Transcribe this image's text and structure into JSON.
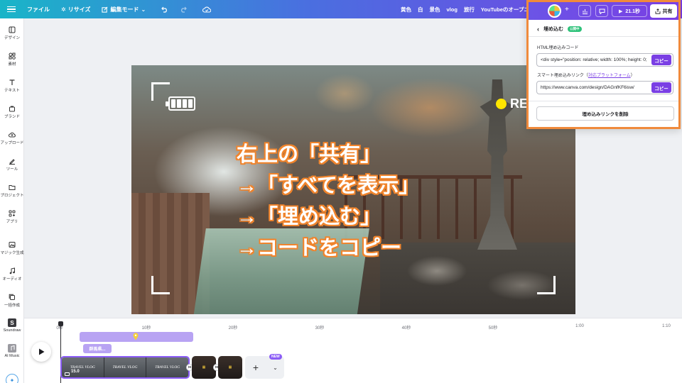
{
  "topbar": {
    "file": "ファイル",
    "resize": "リサイズ",
    "edit_mode": "編集モード",
    "tags": [
      "黄色",
      "白",
      "景色",
      "vlog",
      "旅行",
      "YouTubeのオープニング動画"
    ],
    "duration": "21.1秒",
    "share": "共有"
  },
  "sidebar": {
    "items": [
      {
        "label": "デザイン",
        "icon": "design-icon"
      },
      {
        "label": "素材",
        "icon": "elements-icon"
      },
      {
        "label": "テキスト",
        "icon": "text-icon"
      },
      {
        "label": "ブランド",
        "icon": "brand-icon"
      },
      {
        "label": "アップロード",
        "icon": "upload-icon"
      },
      {
        "label": "ツール",
        "icon": "draw-icon"
      },
      {
        "label": "プロジェクト",
        "icon": "folder-icon"
      },
      {
        "label": "アプリ",
        "icon": "apps-icon"
      },
      {
        "label": "マジック生成",
        "icon": "magic-icon"
      },
      {
        "label": "オーディオ",
        "icon": "music-icon"
      },
      {
        "label": "一括作成",
        "icon": "bulk-icon"
      },
      {
        "label": "Soundraw",
        "icon": "soundraw-icon"
      },
      {
        "label": "AI Music",
        "icon": "ai-music-icon"
      }
    ]
  },
  "canvas": {
    "rec_label": "REC",
    "overlay_lines": [
      "右上の「共有」",
      "→「すべてを表示」",
      "→「埋め込む」",
      "→コードをコピー"
    ]
  },
  "timeline": {
    "ticks": [
      "0秒",
      "10秒",
      "20秒",
      "30秒",
      "40秒",
      "50秒",
      "1:00",
      "1:10"
    ],
    "label_chip": "群馬県...",
    "clip_duration": "15.0",
    "clip_titles": [
      "TRAVEL VLOG",
      "TRAVEL VLOG",
      "TRAVEL VLOG"
    ],
    "new_badge": "NEW"
  },
  "panel": {
    "title": "埋め込む",
    "badge": "公開中",
    "html_label": "HTML埋め込みコード",
    "html_value": "<div style=\"position: relative; width: 100%; height: 0;",
    "copy": "コピー",
    "smart_label": "スマート埋め込みリンク（",
    "smart_link": "対応プラットフォーム",
    "smart_label_end": "）",
    "smart_value": "https://www.canva.com/design/DAGnfKF6isw/",
    "delete": "埋め込みリンクを削除"
  },
  "colors": {
    "accent": "#7a3fe4",
    "highlight_border": "#f08a3c",
    "overlay_stroke": "#f0842c",
    "rec_dot": "#ffe600"
  }
}
